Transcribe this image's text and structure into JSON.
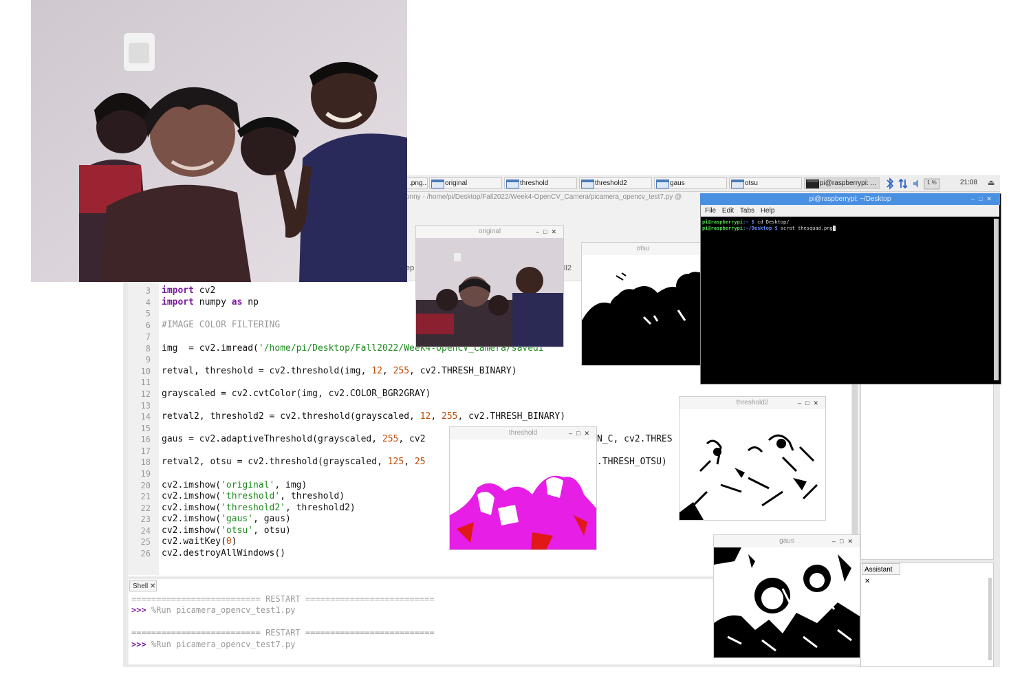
{
  "taskbar": {
    "buttons": [
      {
        "label": ".png..."
      },
      {
        "label": "original"
      },
      {
        "label": "threshold"
      },
      {
        "label": "threshold2"
      },
      {
        "label": "gaus"
      },
      {
        "label": "otsu"
      },
      {
        "label": "pi@raspberrypi: ..."
      }
    ],
    "clock": "21:08",
    "cpu_label": "1 %"
  },
  "thonny": {
    "title": "onny  -  /home/pi/Desktop/Fall2022/Week4-OpenCV_Camera/picamera_opencv_test7.py  @",
    "tab_fragment_left": "ep",
    "tab_fragment_right": "ll2"
  },
  "editor": {
    "lines": [
      {
        "n": "3"
      },
      {
        "n": "4"
      },
      {
        "n": "5"
      },
      {
        "n": "6"
      },
      {
        "n": "7"
      },
      {
        "n": "8"
      },
      {
        "n": "9"
      },
      {
        "n": "10"
      },
      {
        "n": "11"
      },
      {
        "n": "12"
      },
      {
        "n": "13"
      },
      {
        "n": "14"
      },
      {
        "n": "15"
      },
      {
        "n": "16"
      },
      {
        "n": "17"
      },
      {
        "n": "18"
      },
      {
        "n": "19"
      },
      {
        "n": "20"
      },
      {
        "n": "21"
      },
      {
        "n": "22"
      },
      {
        "n": "23"
      },
      {
        "n": "24"
      },
      {
        "n": "25"
      },
      {
        "n": "26"
      }
    ],
    "code": {
      "l3_kw": "import",
      "l3_rest": " cv2",
      "l4_kw": "import",
      "l4_mid": " numpy ",
      "l4_kw2": "as",
      "l4_rest": " np",
      "l6": "#IMAGE COLOR FILTERING",
      "l8_pre": "img  = cv2.imread(",
      "l8_str": "'/home/pi/Desktop/Fall2022/Week4-OpenCV_Camera/savedI",
      "l10_pre": "retval, threshold = cv2.threshold(img, ",
      "l10_n1": "12",
      "l10_sep": ", ",
      "l10_n2": "255",
      "l10_post": ", cv2.THRESH_BINARY)",
      "l12": "grayscaled = cv2.cvtColor(img, cv2.COLOR_BGR2GRAY)",
      "l14_pre": "retval2, threshold2 = cv2.threshold(grayscaled, ",
      "l14_n1": "12",
      "l14_sep": ", ",
      "l14_n2": "255",
      "l14_post": ", cv2.THRESH_BINARY)",
      "l16_pre": "gaus = cv2.adaptiveThreshold(grayscaled, ",
      "l16_n1": "255",
      "l16_post": ", cv2",
      "l16_tail": "N_C, cv2.THRES",
      "l18_pre": "retval2, otsu = cv2.threshold(grayscaled, ",
      "l18_n1": "125",
      "l18_sep": ", ",
      "l18_n2": "25",
      "l18_tail": ".THRESH_OTSU)",
      "l20_pre": "cv2.imshow(",
      "l20_str": "'original'",
      "l20_post": ", img)",
      "l21_pre": "cv2.imshow(",
      "l21_str": "'threshold'",
      "l21_post": ", threshold)",
      "l22_pre": "cv2.imshow(",
      "l22_str": "'threshold2'",
      "l22_post": ", threshold2)",
      "l23_pre": "cv2.imshow(",
      "l23_str": "'gaus'",
      "l23_post": ", gaus)",
      "l24_pre": "cv2.imshow(",
      "l24_str": "'otsu'",
      "l24_post": ", otsu)",
      "l25_pre": "cv2.waitKey(",
      "l25_n": "0",
      "l25_post": ")",
      "l26": "cv2.destroyAllWindows()"
    }
  },
  "shell": {
    "tab_label": "Shell",
    "restart1": "========================== RESTART ==========================",
    "prompt1": ">>>",
    "cmd1": " %Run picamera_opencv_test1.py",
    "restart2": "========================== RESTART ==========================",
    "prompt2": ">>>",
    "cmd2": " %Run picamera_opencv_test7.py"
  },
  "assistant": {
    "tab_label": "Assistant"
  },
  "cv_windows": {
    "original": "original",
    "otsu": "otsu",
    "threshold": "threshold",
    "threshold2": "threshold2",
    "gaus": "gaus"
  },
  "terminal": {
    "title": "pi@raspberrypi: ~/Desktop",
    "menu": [
      "File",
      "Edit",
      "Tabs",
      "Help"
    ],
    "line1_user": "pi@raspberrypi",
    "line1_path": ":~ $",
    "line1_cmd": " cd Desktop/",
    "line2_user": "pi@raspberrypi",
    "line2_path": ":~/Desktop $",
    "line2_cmd": " scrot thesquad.png"
  },
  "colors": {
    "terminal_titlebar": "#4a90e2",
    "keyword": "#7a1a9c",
    "string": "#1c8a1c",
    "number": "#c04a00",
    "threshold_magenta": "#e61ee6",
    "threshold_red": "#e01818"
  }
}
